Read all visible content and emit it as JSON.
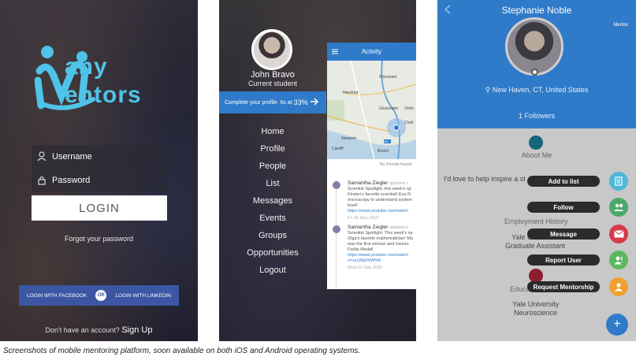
{
  "login": {
    "logo_line1": "any",
    "logo_line2": "entors",
    "username_label": "Username",
    "password_label": "Password",
    "login_button": "LOGIN",
    "forgot_password": "Forgot your password",
    "facebook_button": "LOGIN WITH FACEBOOK",
    "or_label": "OR",
    "linkedin_button": "LOGIN WITH LINKEDIN",
    "no_account": "Don't have an account?",
    "sign_up": "Sign Up"
  },
  "menu": {
    "user_name": "John  Bravo",
    "user_role": "Current student",
    "complete_profile": "Complete your profile. Its at",
    "complete_pct": "33%",
    "items": [
      "Home",
      "Profile",
      "People",
      "List",
      "Messages",
      "Events",
      "Groups",
      "Opportunities",
      "Logout"
    ],
    "activity_title": "Activity",
    "no_friends": "No friends found",
    "map_labels": [
      "Worcester",
      "Hereford",
      "Gloucester",
      "Oxfor",
      "Chelt",
      "M5",
      "Cardiff",
      "Bristol",
      "Newport"
    ],
    "feed": [
      {
        "name": "Samantha Ziegler",
        "meta": "updated s",
        "text": "Scientist Spotlight: this week's sp Kirsten's favorite scientist! Eva N microscopy to understand system level!",
        "link": "https://www.youtube.com/watch",
        "date": "Fri 30 Sep 2016"
      },
      {
        "name": "Samantha Ziegler",
        "meta": "updated s",
        "text": "Scientist Spotlight: This week's sp Olga's favorite mathematician! Ma was the first woman and Iranian Fields Medal!",
        "link": "https://www.youtube.com/watch v=sxLWjHXMI5M",
        "date": "Wed 21 Sep 2016"
      }
    ]
  },
  "profile": {
    "name": "Stephanie  Noble",
    "role_tag": "Mentor",
    "location": "New Haven, CT, United States",
    "followers": "1 Followers",
    "about_label": "About Me",
    "about_text": "I'd love to help inspire a st",
    "employment_label": "Employment History",
    "employment_uni": "Yale U",
    "employment_role": "Graduate Assistant",
    "education_label": "Educa",
    "education_uni": "Yale University",
    "education_field": "Neuroscience",
    "actions": [
      "Add to list",
      "Follow",
      "Message",
      "Report User",
      "Request Mentorship"
    ],
    "fab_add": "+"
  },
  "colors": {
    "brand_blue": "#2f7bc9",
    "facebook_blue": "#3b57a3",
    "logo_cyan": "#4fc3e8",
    "fab_teal": "#4fb8d6",
    "fab_green": "#4aa86a",
    "fab_red": "#d63a4a",
    "fab_lime": "#5cb860",
    "fab_orange": "#f0a030"
  },
  "caption": "Screenshots of mobile mentoring platform, soon available on both iOS and Android operating systems."
}
